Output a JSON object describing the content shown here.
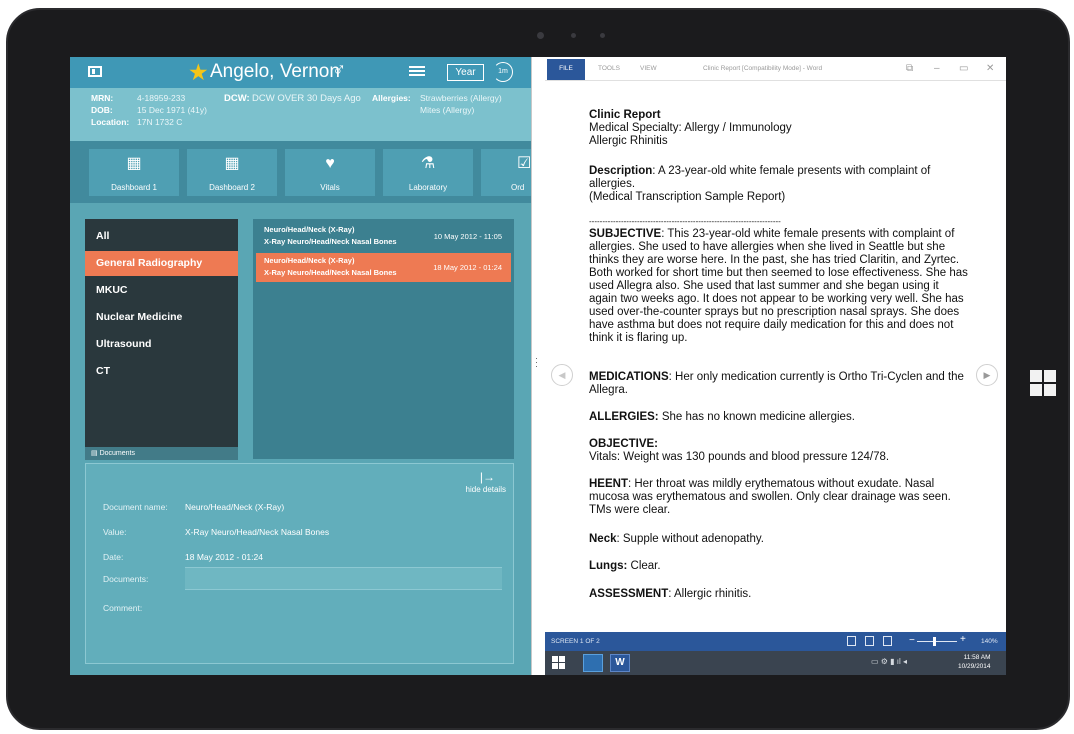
{
  "left_app": {
    "patient_name": "Angelo, Vernon",
    "gender_symbol": "♂",
    "star_icon": "★",
    "year_button": "Year",
    "refresh_badge": "1m",
    "info": {
      "mrn_label": "MRN:",
      "mrn_value": "4-18959-233",
      "dob_label": "DOB:",
      "dob_value": "15 Dec 1971 (41y)",
      "location_label": "Location:",
      "location_value": "17N 1732 C",
      "dcw_label": "DCW:",
      "dcw_value": "DCW OVER 30 Days Ago",
      "allergies_label": "Allergies:",
      "allergies_value_1": "Strawberries (Allergy)",
      "allergies_value_2": "Mites (Allergy)"
    },
    "tiles": [
      {
        "label": "Dashboard 1",
        "icon": "dashboard-icon"
      },
      {
        "label": "Dashboard 2",
        "icon": "dashboard-icon"
      },
      {
        "label": "Vitals",
        "icon": "heart-icon"
      },
      {
        "label": "Laboratory",
        "icon": "flask-icon"
      },
      {
        "label": "Ord",
        "icon": "order-icon"
      }
    ],
    "categories": [
      "All",
      "General Radiography",
      "MKUC",
      "Nuclear Medicine",
      "Ultrasound",
      "CT"
    ],
    "active_category": "General Radiography",
    "documents_label": "Documents",
    "items": [
      {
        "title": "Neuro/Head/Neck (X-Ray)",
        "subtitle": "X-Ray Neuro/Head/Neck Nasal Bones",
        "date": "10 May 2012 - 11:05",
        "selected": false
      },
      {
        "title": "Neuro/Head/Neck (X-Ray)",
        "subtitle": "X-Ray Neuro/Head/Neck Nasal Bones",
        "date": "18 May 2012 - 01:24",
        "selected": true
      }
    ],
    "details": {
      "hide_arrow": "|→",
      "hide_label": "hide details",
      "name_label": "Document name:",
      "name_value": "Neuro/Head/Neck (X-Ray)",
      "value_label": "Value:",
      "value_value": "X-Ray Neuro/Head/Neck Nasal Bones",
      "date_label": "Date:",
      "date_value": "18 May 2012 - 01:24",
      "documents_label": "Documents:",
      "comment_label": "Comment:"
    }
  },
  "word": {
    "tabs": [
      "FILE",
      "TOOLS",
      "VIEW"
    ],
    "title": "Clinic Report [Compatibility Mode] - Word",
    "report_title": "Clinic Report",
    "specialty": "Medical Specialty: Allergy / Immunology",
    "subspecialty": "Allergic Rhinitis",
    "description_label": "Description",
    "description_text": ": A 23-year-old white female presents with complaint of allergies.",
    "description_note": "(Medical Transcription Sample Report)",
    "separator": "------------------------------------------------------------------------",
    "subjective_label": "SUBJECTIVE",
    "subjective_text": ": This 23-year-old white female presents with complaint of allergies. She used to have allergies when she lived in Seattle but she thinks they are worse here. In the past, she has tried Claritin, and Zyrtec. Both worked for short time but then seemed to lose effectiveness. She has used Allegra also. She used that last summer and she began using it again two weeks ago. It does not appear to be working very well. She has used over-the-counter sprays but no prescription nasal sprays. She does have asthma but does not require daily medication for this and does not think it is flaring up.",
    "medications_label": "MEDICATIONS",
    "medications_text": ": Her only medication currently is Ortho Tri-Cyclen and the Allegra.",
    "allergies_label": "ALLERGIES:",
    "allergies_text": " She has no known medicine allergies.",
    "objective_label": "OBJECTIVE:",
    "objective_text": "Vitals: Weight was 130 pounds and blood pressure 124/78.",
    "heent_label": "HEENT",
    "heent_text": ": Her throat was mildly erythematous without exudate. Nasal mucosa was erythematous and swollen. Only clear drainage was seen. TMs were clear.",
    "neck_label": "Neck",
    "neck_text": ": Supple without adenopathy.",
    "lungs_label": "Lungs:",
    "lungs_text": " Clear.",
    "assessment_label": "ASSESSMENT",
    "assessment_text": ": Allergic rhinitis.",
    "status_left": "SCREEN 1 OF 2",
    "zoom": "140%"
  },
  "taskbar": {
    "time": "11:58 AM",
    "date": "10/29/2014"
  }
}
